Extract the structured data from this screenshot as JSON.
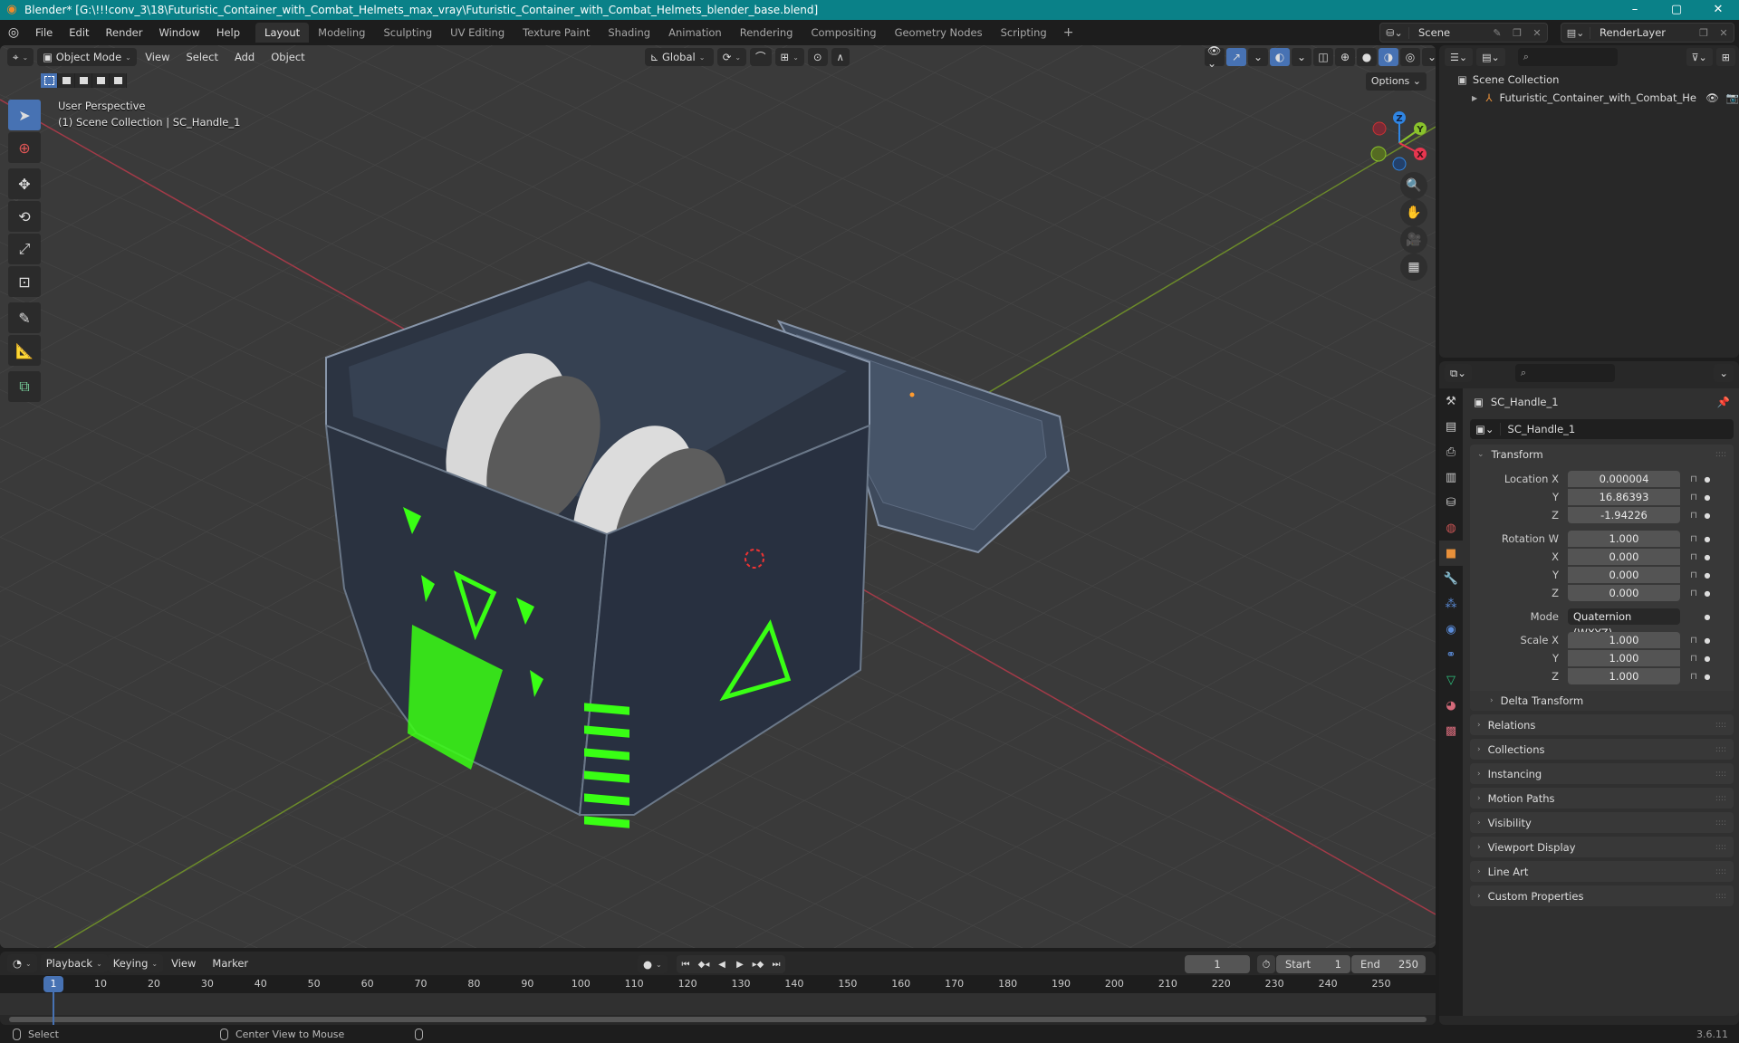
{
  "window": {
    "title": "Blender* [G:\\!!!conv_3\\18\\Futuristic_Container_with_Combat_Helmets_max_vray\\Futuristic_Container_with_Combat_Helmets_blender_base.blend]",
    "controls": [
      "–",
      "▢",
      "✕"
    ]
  },
  "menu": {
    "items": [
      "File",
      "Edit",
      "Render",
      "Window",
      "Help"
    ],
    "workspaces": [
      "Layout",
      "Modeling",
      "Sculpting",
      "UV Editing",
      "Texture Paint",
      "Shading",
      "Animation",
      "Rendering",
      "Compositing",
      "Geometry Nodes",
      "Scripting"
    ],
    "active_workspace": "Layout",
    "add_workspace": "+",
    "scene": "Scene",
    "view_layer": "RenderLayer"
  },
  "viewport": {
    "mode": "Object Mode",
    "menus": [
      "View",
      "Select",
      "Add",
      "Object"
    ],
    "transform_orientation": "Global",
    "options_label": "Options",
    "perspective_label": "User Perspective",
    "context_label": "(1) Scene Collection | SC_Handle_1",
    "gizmo_axes": [
      "X",
      "Y",
      "Z"
    ],
    "colors": {
      "x": "#e8364f",
      "y": "#8ac32c",
      "z": "#2f85e3",
      "accent": "#4772b3",
      "glow": "#39ff14"
    }
  },
  "outliner": {
    "search_placeholder": "",
    "root": "Scene Collection",
    "items": [
      {
        "name": "Futuristic_Container_with_Combat_Helr",
        "visible": true
      }
    ]
  },
  "properties": {
    "object_name": "SC_Handle_1",
    "data_name": "SC_Handle_1",
    "transform": {
      "title": "Transform",
      "location": {
        "label": "Location X",
        "x": "0.000004",
        "y": "16.86393",
        "z": "-1.94226"
      },
      "rotation": {
        "label": "Rotation W",
        "w": "1.000",
        "x": "0.000",
        "y": "0.000",
        "z": "0.000"
      },
      "mode_label": "Mode",
      "mode": "Quaternion (WXYZ)",
      "scale": {
        "label": "Scale X",
        "x": "1.000",
        "y": "1.000",
        "z": "1.000"
      },
      "axis_labels": [
        "X",
        "Y",
        "Z"
      ]
    },
    "delta_transform": "Delta Transform",
    "panels": [
      "Relations",
      "Collections",
      "Instancing",
      "Motion Paths",
      "Visibility",
      "Viewport Display",
      "Line Art",
      "Custom Properties"
    ]
  },
  "timeline": {
    "menus": [
      "Playback",
      "Keying",
      "View",
      "Marker"
    ],
    "current_frame": "1",
    "start_label": "Start",
    "start": "1",
    "end_label": "End",
    "end": "250",
    "ticks": [
      "10",
      "20",
      "30",
      "40",
      "50",
      "60",
      "70",
      "80",
      "90",
      "100",
      "110",
      "120",
      "130",
      "140",
      "150",
      "160",
      "170",
      "180",
      "190",
      "200",
      "210",
      "220",
      "230",
      "240",
      "250"
    ]
  },
  "status": {
    "left_hint": "Select",
    "middle_hint": "Center View to Mouse",
    "version": "3.6.11"
  }
}
